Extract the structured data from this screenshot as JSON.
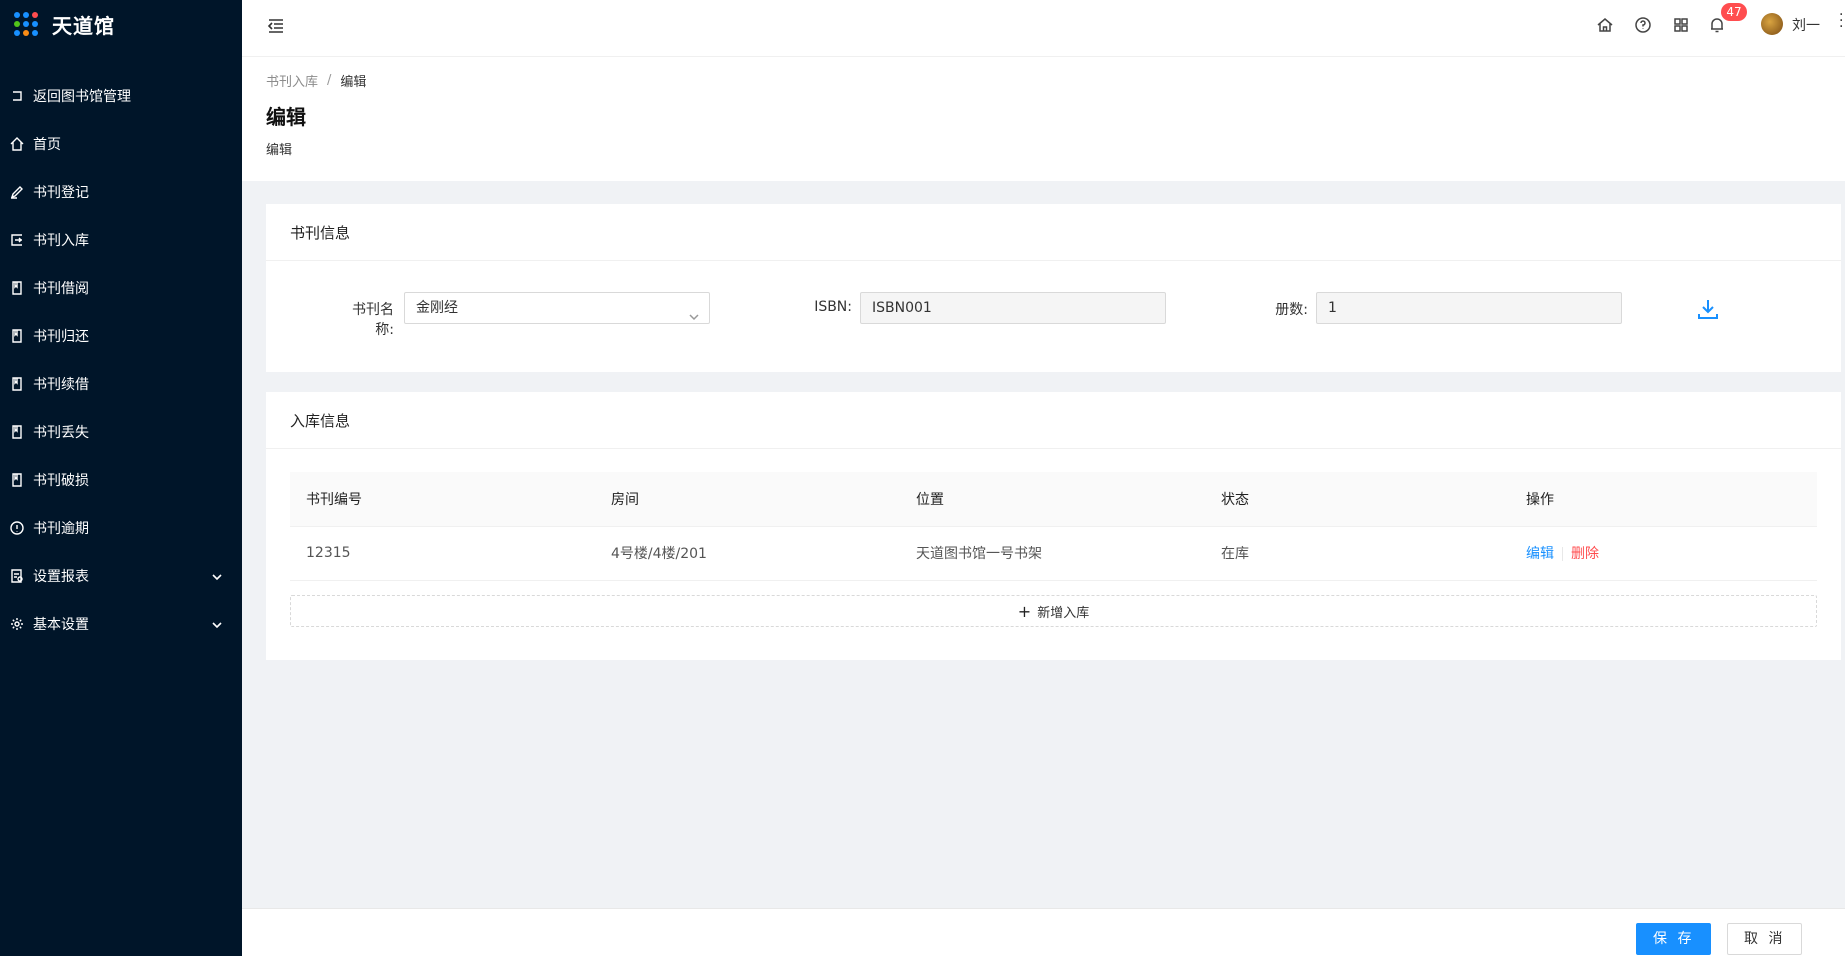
{
  "app": {
    "title": "天道馆"
  },
  "sidebar": {
    "items": [
      {
        "label": "返回图书馆管理",
        "icon": "return-icon"
      },
      {
        "label": "首页",
        "icon": "home-icon"
      },
      {
        "label": "书刊登记",
        "icon": "register-icon"
      },
      {
        "label": "书刊入库",
        "icon": "import-icon"
      },
      {
        "label": "书刊借阅",
        "icon": "book-icon"
      },
      {
        "label": "书刊归还",
        "icon": "book-icon"
      },
      {
        "label": "书刊续借",
        "icon": "book-icon"
      },
      {
        "label": "书刊丢失",
        "icon": "book-icon"
      },
      {
        "label": "书刊破损",
        "icon": "book-icon"
      },
      {
        "label": "书刊逾期",
        "icon": "exclamation-icon"
      },
      {
        "label": "设置报表",
        "icon": "report-icon"
      },
      {
        "label": "基本设置",
        "icon": "gear-icon"
      }
    ]
  },
  "header": {
    "notification_count": "47",
    "username": "刘一"
  },
  "breadcrumb": {
    "parent": "书刊入库",
    "separator": "/",
    "current": "编辑"
  },
  "page": {
    "title": "编辑",
    "description": "编辑"
  },
  "book_info": {
    "title": "书刊信息",
    "name_label": "书刊名称:",
    "name_value": "金刚经",
    "isbn_label": "ISBN:",
    "isbn_value": "ISBN001",
    "count_label": "册数:",
    "count_value": "1"
  },
  "storage_info": {
    "title": "入库信息",
    "columns": [
      "书刊编号",
      "房间",
      "位置",
      "状态",
      "操作"
    ],
    "rows": [
      {
        "code": "12315",
        "room": "4号楼/4楼/201",
        "location": "天道图书馆一号书架",
        "status": "在库",
        "edit": "编辑",
        "delete": "删除"
      }
    ],
    "add_label": "新增入库"
  },
  "footer": {
    "save": "保 存",
    "cancel": "取 消"
  },
  "colors": {
    "sidebar": "#001529",
    "primary": "#1890ff",
    "danger": "#ff4d4f"
  }
}
